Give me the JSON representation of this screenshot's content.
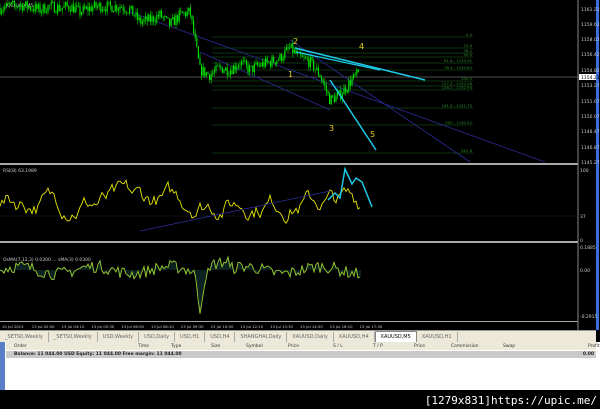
{
  "chart": {
    "title": "XAUUSD,M5",
    "current_price": "1154.21",
    "price_ticks": [
      "1161.22",
      "1159.62",
      "1158.02",
      "1156.42",
      "1154.82",
      "1153.27",
      "1151.67",
      "1150.07",
      "1148.47",
      "1146.87",
      "1145.27"
    ],
    "close_path": [
      1161.32,
      1161.53,
      1161.64,
      1161.43,
      1161.12,
      1161.53,
      1161.32,
      1161.53,
      1160.91,
      1161.32,
      1161.53,
      1161.43,
      1161.53,
      1161.12,
      1159.86,
      1160.07,
      1160.59,
      1159.55,
      1160.59,
      1160.91,
      1154.86,
      1154.34,
      1155.07,
      1154.86,
      1155.69,
      1154.86,
      1155.38,
      1155.69,
      1156.11,
      1157.15,
      1156.11,
      1155.69,
      1154.34,
      1151.73,
      1152.25,
      1153.61,
      1154.65
    ],
    "fib_levels": [
      "0.0",
      "23.6",
      "38.2",
      "50.0",
      "61.8 - 1155.31",
      "76.4 - 1154.84",
      "100.0",
      "127.2 - 1153.28",
      "138.2 - 1152.94",
      "161.8 - 1151.75",
      "200 - 1150.52",
      "261.8"
    ],
    "wave_labels": [
      "1",
      "2",
      "3",
      "4",
      "5"
    ],
    "colors": {
      "candles": "#00e000",
      "fib": "#1d6b1d",
      "trend": "#2c2c9a",
      "wave_line": "#1ec8e6",
      "wave_label": "#e8d21e"
    }
  },
  "rsi": {
    "label": "RSI(8) 63.1989",
    "ticks": [
      "100",
      "37",
      "0"
    ],
    "color": "#e6e600"
  },
  "osma": {
    "label": "OsMA(7,12,3) 0.0300 ... sMA(3) 0.0300",
    "ticks": [
      "0.1885",
      "0.00",
      "-0.2915"
    ],
    "color": "#9acd32"
  },
  "time_axis": [
    "10 Jul 2015",
    "13 Jul 02:50",
    "13 Jul 04:10",
    "13 Jul 05:30",
    "13 Jul 06:50",
    "13 Jul 08:10",
    "13 Jul 09:30",
    "13 Jul 10:50",
    "13 Jul 12:10",
    "13 Jul 13:30",
    "13 Jul 14:50",
    "13 Jul 16:10",
    "13 Jul 17:30"
  ],
  "tabs": [
    "_SETS0,Weekly",
    "_SETS0,Weekly",
    "USD,Weekly",
    "USD,Daily",
    "USD,H1",
    "USD,H4",
    "SHANGHAI,Daily",
    "XAUUSD,Daily",
    "XAUUSD,H4",
    "XAUUSD,M5",
    "XAUUSD,H1"
  ],
  "active_tab": "XAUUSD,M5",
  "terminal": {
    "columns": [
      "Order",
      "Time",
      "Type",
      "Size",
      "Symbol",
      "Price",
      "S / L",
      "T / P",
      "Price",
      "Commission",
      "Swap",
      "Profit"
    ],
    "balance": "Balance: 11 044.00 USD  Equity: 11 044.00  Free margin: 11 044.00",
    "profit": "0.00"
  },
  "watermark": "[1279x831]https://upic.me/"
}
